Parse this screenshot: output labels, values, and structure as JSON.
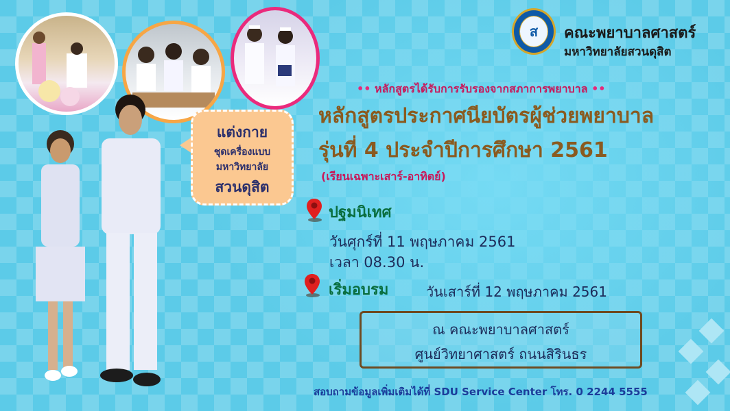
{
  "header": {
    "faculty": "คณะพยาบาลศาสตร์",
    "university": "มหาวิทยาลัยสวนดุสิต"
  },
  "program": {
    "accreditation": "หลักสูตรได้รับการรับรองจากสภาการพยาบาล",
    "title_line1": "หลักสูตรประกาศนียบัตรผู้ช่วยพยาบาล",
    "title_line2": "รุ่นที่ 4 ประจำปีการศึกษา 2561",
    "schedule_note": "(เรียนเฉพาะเสาร์-อาทิตย์)"
  },
  "orientation": {
    "title": "ปฐมนิเทศ",
    "date": "วันศุกร์ที่  11 พฤษภาคม 2561",
    "time": "เวลา 08.30 น."
  },
  "training_start": {
    "title": "เริ่มอบรม",
    "date": "วันเสาร์ที่ 12  พฤษภาคม 2561"
  },
  "venue": {
    "line1": "ณ คณะพยาบาลศาสตร์",
    "line2": "ศูนย์วิทยาศาสตร์ ถนนสิรินธร"
  },
  "dress_code": {
    "line1": "แต่งกาย",
    "line2": "ชุดเครื่องแบบ",
    "line3": "มหาวิทยาลัย",
    "line4": "สวนดุสิต"
  },
  "contact": "สอบถามข้อมูลเพิ่มเติมได้ที่ SDU Service Center  โทร. 0 2244 5555",
  "colors": {
    "background": "#5ccbe8",
    "title": "#8a5a1f",
    "accent_pink": "#c8185a",
    "green": "#0a6e3f",
    "pin_red": "#e0201f"
  }
}
